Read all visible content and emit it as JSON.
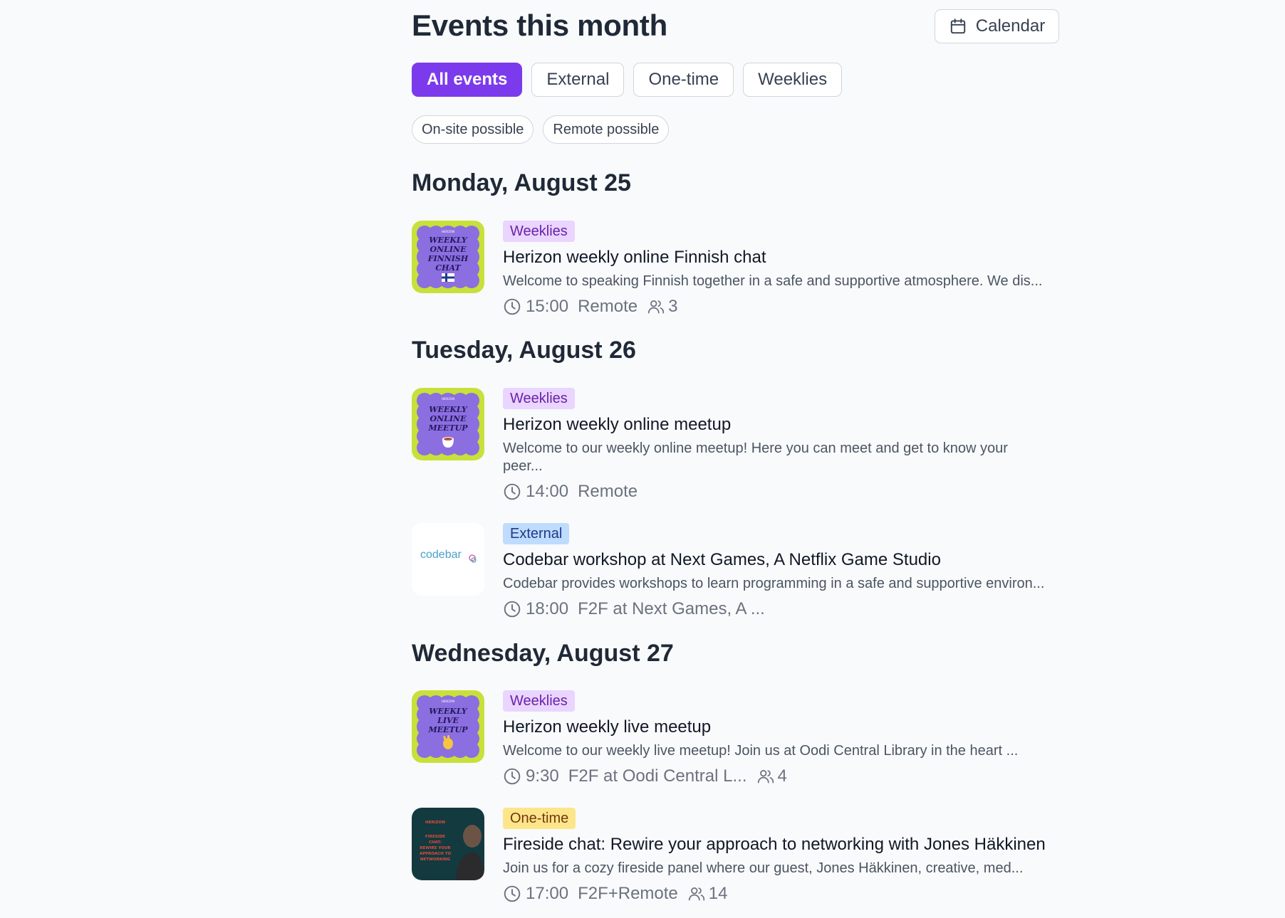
{
  "header": {
    "title": "Events this month",
    "calendar_label": "Calendar"
  },
  "tabs": [
    {
      "label": "All events",
      "active": true
    },
    {
      "label": "External",
      "active": false
    },
    {
      "label": "One-time",
      "active": false
    },
    {
      "label": "Weeklies",
      "active": false
    }
  ],
  "chips": [
    "On-site possible",
    "Remote possible"
  ],
  "colors": {
    "accent": "#7c3aed",
    "weekly_badge_bg": "#e9d5ff",
    "external_badge_bg": "#bfdbfe",
    "onetime_badge_bg": "#fde68a",
    "thumb_purple": "#8b6ee0",
    "thumb_lime": "#c8e03a"
  },
  "days": [
    {
      "heading": "Monday, August 25",
      "events": [
        {
          "badge": "Weeklies",
          "title": "Herizon weekly online Finnish chat",
          "description": "Welcome to speaking Finnish together in a safe and supportive atmosphere. We dis...",
          "time": "15:00",
          "location": "Remote",
          "attendees": "3",
          "thumb": {
            "brand": "HERIZON",
            "text": [
              "WEEKLY",
              "ONLINE",
              "FINNISH",
              "CHAT"
            ],
            "icon": "finnish-flag-icon"
          }
        }
      ]
    },
    {
      "heading": "Tuesday, August 26",
      "events": [
        {
          "badge": "Weeklies",
          "title": "Herizon weekly online meetup",
          "description": "Welcome to our weekly online meetup! Here you can meet and get to know your peer...",
          "time": "14:00",
          "location": "Remote",
          "thumb": {
            "brand": "HERIZON",
            "text": [
              "WEEKLY",
              "ONLINE",
              "MEETUP"
            ],
            "icon": "coffee-cup-icon"
          }
        },
        {
          "badge": "External",
          "title": "Codebar workshop at Next Games, A Netflix Game Studio",
          "description": "Codebar provides workshops to learn programming in a safe and supportive environ...",
          "time": "18:00",
          "location": "F2F at Next Games, A ...",
          "thumb": {
            "logo_text": "codebar"
          }
        }
      ]
    },
    {
      "heading": "Wednesday, August 27",
      "events": [
        {
          "badge": "Weeklies",
          "title": "Herizon weekly live meetup",
          "description": "Welcome to our weekly live meetup! Join us at Oodi Central Library in the heart ...",
          "time": "9:30",
          "location": "F2F at Oodi Central L...",
          "attendees": "4",
          "thumb": {
            "brand": "HERIZON",
            "text": [
              "WEEKLY",
              "LIVE",
              "MEETUP"
            ],
            "icon": "waving-hand-icon"
          }
        },
        {
          "badge": "One-time",
          "title": "Fireside chat: Rewire your approach to networking with Jones Häkkinen",
          "description": "Join us for a cozy fireside panel where our guest, Jones Häkkinen, creative, med...",
          "time": "17:00",
          "location": "F2F+Remote",
          "attendees": "14",
          "thumb": {
            "brand": "HERIZON",
            "text": [
              "FIRESIDE",
              "CHAT:",
              "REWIRE YOUR",
              "APPROACH TO",
              "NETWORKING"
            ]
          }
        }
      ]
    }
  ]
}
